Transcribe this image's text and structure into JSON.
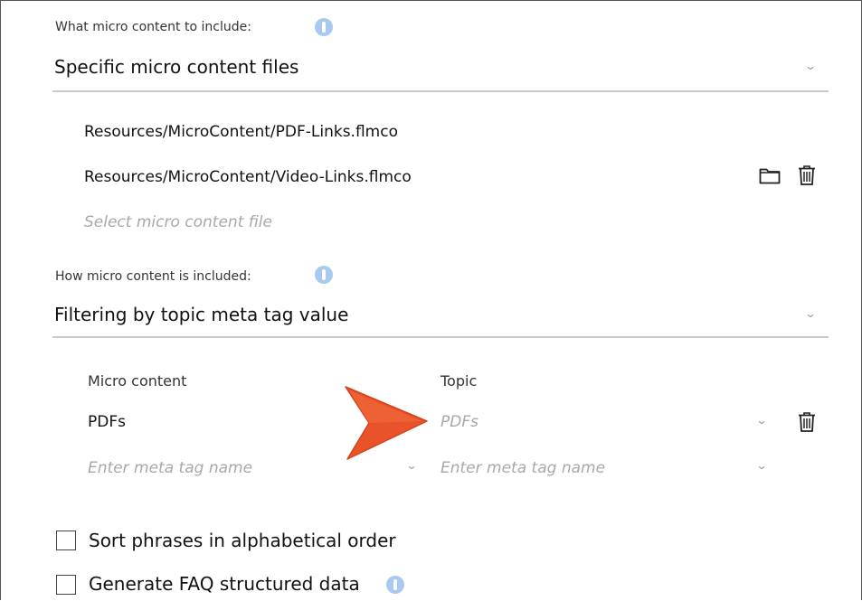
{
  "include_section": {
    "label": "What micro content to include:",
    "selected_value": "Specific micro content files",
    "files": [
      "Resources/MicroContent/PDF-Links.flmco",
      "Resources/MicroContent/Video-Links.flmco"
    ],
    "file_placeholder": "Select micro content file"
  },
  "how_section": {
    "label": "How micro content is included:",
    "selected_value": "Filtering by topic meta tag value"
  },
  "mapping_table": {
    "col_micro_content": "Micro content",
    "col_topic": "Topic",
    "row_micro_value": "PDFs",
    "row_topic_value": "PDFs",
    "new_micro_placeholder": "Enter meta tag name",
    "new_topic_placeholder": "Enter meta tag name"
  },
  "options": {
    "sort_label": "Sort phrases in alphabetical order",
    "sort_checked": false,
    "faq_label": "Generate FAQ structured data",
    "faq_checked": false
  },
  "icons": {
    "info": "info-icon",
    "folder": "folder-icon",
    "trash": "trash-icon",
    "chevron": "chevron-down-icon",
    "arrow": "callout-arrow-icon"
  },
  "colors": {
    "info_blue": "#a9c9ef",
    "callout_orange": "#e8532a"
  }
}
